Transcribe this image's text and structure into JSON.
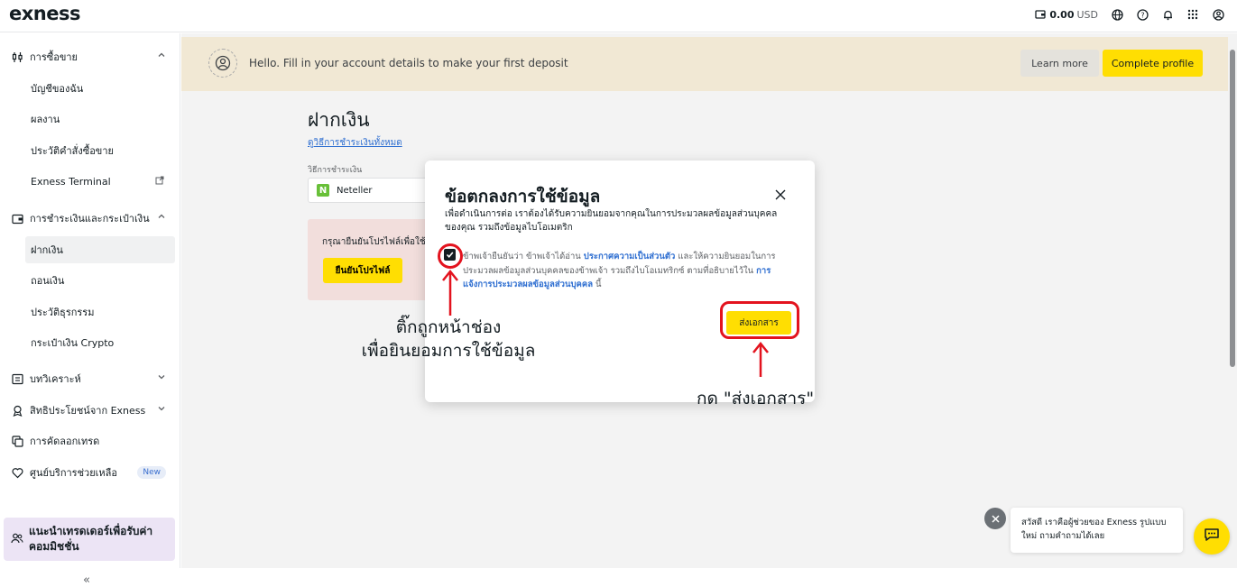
{
  "header": {
    "logo": "exness",
    "balance_amount": "0.00",
    "balance_currency": "USD"
  },
  "sidebar": {
    "trading": "การซื้อขาย",
    "trading_items": [
      "บัญชีของฉัน",
      "ผลงาน",
      "ประวัติคำสั่งซื้อขาย",
      "Exness Terminal"
    ],
    "payments": "การชำระเงินและกระเป๋าเงิน",
    "payments_items": [
      "ฝากเงิน",
      "ถอนเงิน",
      "ประวัติธุรกรรม",
      "กระเป๋าเงิน Crypto"
    ],
    "analytics": "บทวิเคราะห์",
    "benefits": "สิทธิประโยชน์จาก Exness",
    "copytrade": "การคัดลอกเทรด",
    "support": "ศูนย์บริการช่วยเหลือ",
    "support_badge": "New",
    "promo": "แนะนำเทรดเดอร์เพื่อรับค่าคอมมิชชั่น",
    "collapse_glyph": "«"
  },
  "banner": {
    "text": "Hello. Fill in your account details to make your first deposit",
    "learn_more": "Learn more",
    "complete_profile": "Complete profile"
  },
  "deposit": {
    "title": "ฝากเงิน",
    "view_all_link": "ดูวิธีการชำระเงินทั้งหมด",
    "method_label": "วิธีการชำระเงิน",
    "method_value": "Neteller",
    "method_logo_letter": "N",
    "warning_text": "กรุณายืนยันโปรไฟล์เพื่อใช้",
    "verify_button": "ยืนยันโปรไฟล์"
  },
  "modal": {
    "title": "ข้อตกลงการใช้ข้อมูล",
    "description": "เพื่อดำเนินการต่อ เราต้องได้รับความยินยอมจากคุณในการประมวลผลข้อมูลส่วนบุคคลของคุณ รวมถึงข้อมูลไบโอเมตริก",
    "consent_part1": "ข้าพเจ้ายืนยันว่า ข้าพเจ้าได้อ่าน ",
    "consent_link1": "ประกาศความเป็นส่วนตัว",
    "consent_part2": " และให้ความยินยอมในการประมวลผลข้อมูลส่วนบุคคลของข้าพเจ้า รวมถึงไบโอเมทริกซ์ ตามที่อธิบายไว้ใน ",
    "consent_link2": "การแจ้งการประมวลผลข้อมูลส่วนบุคคล",
    "consent_part3": " นี้",
    "checked": true,
    "submit": "ส่งเอกสาร"
  },
  "annotations": {
    "check_line1": "ติ๊กถูกหน้าช่อง",
    "check_line2": "เพื่อยินยอมการใช้ข้อมูล",
    "submit_hint": "กด \"ส่งเอกสาร\"",
    "highlight_color": "#e3131e"
  },
  "chat": {
    "message": "สวัสดี เราคือผู้ช่วยของ Exness รูปแบบใหม่ ถามคำถามได้เลย"
  },
  "colors": {
    "brand_yellow": "#ffde02",
    "link_blue": "#2f6fd1",
    "banner_bg": "#f1e8d4",
    "warning_bg": "#f2dedc",
    "promo_bg": "#ece4f5"
  }
}
